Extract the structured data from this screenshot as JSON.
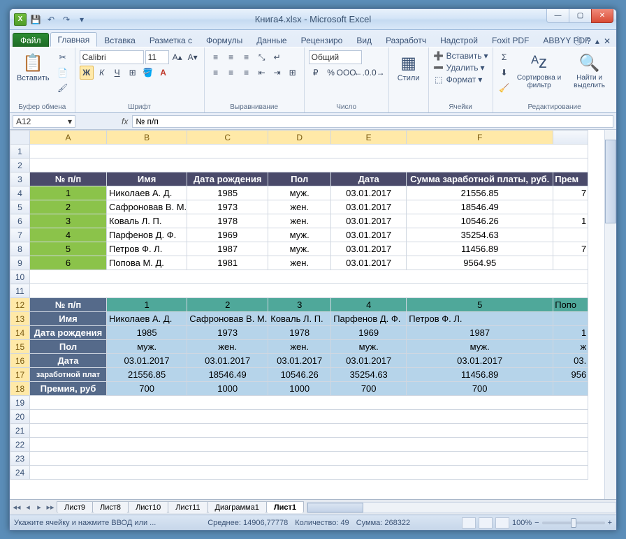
{
  "title": "Книга4.xlsx  -  Microsoft Excel",
  "qat": {
    "save": "💾",
    "undo": "↶",
    "redo": "↷",
    "dd": "▾"
  },
  "win": {
    "min": "—",
    "max": "▢",
    "close": "✕"
  },
  "tabs": {
    "file": "Файл",
    "home": "Главная",
    "insert": "Вставка",
    "layout": "Разметка с",
    "formulas": "Формулы",
    "data": "Данные",
    "review": "Рецензиро",
    "view": "Вид",
    "dev": "Разработч",
    "addins": "Надстрой",
    "foxit": "Foxit PDF",
    "abbyy": "ABBYY PDF"
  },
  "help_icons": {
    "info": "ⓘ",
    "help": "?",
    "min": "▴",
    "x": "✕"
  },
  "ribbon": {
    "clipboard": {
      "paste": "Вставить",
      "label": "Буфер обмена",
      "cut": "✂",
      "copy": "📄",
      "brush": "🖌"
    },
    "font": {
      "name": "Calibri",
      "size": "11",
      "label": "Шрифт",
      "bold": "Ж",
      "italic": "К",
      "underline": "Ч",
      "border": "⊞",
      "fill": "🪣",
      "color": "A"
    },
    "align": {
      "label": "Выравнивание",
      "wrap": "↵",
      "merge": "⊞"
    },
    "number": {
      "format": "Общий",
      "label": "Число",
      "pct": "%",
      "comma": "ООО",
      "dec1": "←.0",
      "dec2": ".0→"
    },
    "styles": {
      "cond": "▦",
      "fmt": "▦",
      "label": "Стили",
      "styles": "Стили"
    },
    "cells": {
      "insert": "Вставить",
      "delete": "Удалить",
      "format": "Формат",
      "label": "Ячейки",
      "icn_i": "➕",
      "icn_d": "➖",
      "icn_f": "⬚"
    },
    "editing": {
      "sum": "Σ",
      "fill": "⬇",
      "clear": "🧹",
      "sort": "Сортировка и фильтр",
      "find": "Найти и выделить",
      "label": "Редактирование",
      "sort_icn": "ᴬᴢ",
      "find_icn": "🔍"
    }
  },
  "namebox": "A12",
  "formula": "№ п/п",
  "cols": [
    "A",
    "B",
    "C",
    "D",
    "E",
    "F"
  ],
  "rowN": [
    1,
    2,
    3,
    4,
    5,
    6,
    7,
    8,
    9,
    10,
    11,
    12,
    13,
    14,
    15,
    16,
    17,
    18,
    19,
    20,
    21,
    22,
    23,
    24
  ],
  "t1": {
    "headers": [
      "№ п/п",
      "Имя",
      "Дата рождения",
      "Пол",
      "Дата",
      "Сумма заработной платы, руб.",
      "Прем"
    ],
    "rows": [
      [
        "1",
        "Николаев А. Д.",
        "1985",
        "муж.",
        "03.01.2017",
        "21556.85",
        "7"
      ],
      [
        "2",
        "Сафроновав В. М.",
        "1973",
        "жен.",
        "03.01.2017",
        "18546.49",
        ""
      ],
      [
        "3",
        "Коваль Л. П.",
        "1978",
        "жен.",
        "03.01.2017",
        "10546.26",
        "1"
      ],
      [
        "4",
        "Парфенов Д. Ф.",
        "1969",
        "муж.",
        "03.01.2017",
        "35254.63",
        ""
      ],
      [
        "5",
        "Петров Ф. Л.",
        "1987",
        "муж.",
        "03.01.2017",
        "11456.89",
        "7"
      ],
      [
        "6",
        "Попова М. Д.",
        "1981",
        "жен.",
        "03.01.2017",
        "9564.95",
        ""
      ]
    ]
  },
  "t2": {
    "r12": [
      "№ п/п",
      "1",
      "2",
      "3",
      "4",
      "5",
      "Попо"
    ],
    "r13": [
      "Имя",
      "Николаев А. Д.",
      "Сафроновав В. М.",
      "Коваль Л. П.",
      "Парфенов Д. Ф.",
      "Петров Ф. Л.",
      ""
    ],
    "r14": [
      "Дата рождения",
      "1985",
      "1973",
      "1978",
      "1969",
      "1987",
      "1"
    ],
    "r15": [
      "Пол",
      "муж.",
      "жен.",
      "жен.",
      "муж.",
      "муж.",
      "ж"
    ],
    "r16": [
      "Дата",
      "03.01.2017",
      "03.01.2017",
      "03.01.2017",
      "03.01.2017",
      "03.01.2017",
      "03."
    ],
    "r17": [
      "заработной плат",
      "21556.85",
      "18546.49",
      "10546.26",
      "35254.63",
      "11456.89",
      "956"
    ],
    "r18": [
      "Премия, руб",
      "700",
      "1000",
      "1000",
      "700",
      "700",
      ""
    ]
  },
  "sheets": {
    "nav": [
      "◂◂",
      "◂",
      "▸",
      "▸▸"
    ],
    "s1": "Лист9",
    "s2": "Лист8",
    "s3": "Лист10",
    "s4": "Лист11",
    "s5": "Диаграмма1",
    "s6": "Лист1"
  },
  "status": {
    "left": "Укажите ячейку и нажмите ВВОД или ...",
    "avg_l": "Среднее:",
    "avg_v": "14906,77778",
    "cnt_l": "Количество:",
    "cnt_v": "49",
    "sum_l": "Сумма:",
    "sum_v": "268322",
    "zoom": "100%",
    "minus": "−",
    "plus": "+"
  }
}
